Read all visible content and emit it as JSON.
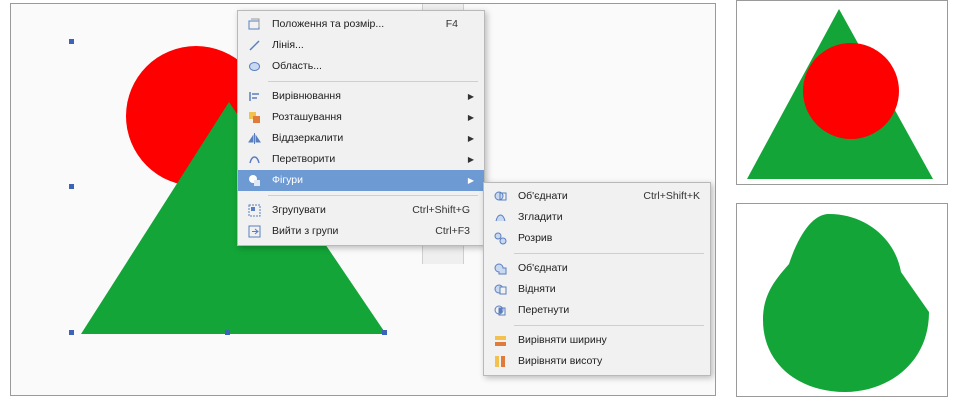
{
  "colors": {
    "shape_red": "#ff0000",
    "shape_green": "#13a538",
    "menu_highlight": "#6e9ad3",
    "menu_background": "#f1f1f1",
    "selection_handle": "#3b63b8"
  },
  "context_menu": {
    "items": [
      {
        "label": "Положення та розмір...",
        "shortcut": "F4",
        "icon": "position-size-icon"
      },
      {
        "label": "Лінія...",
        "shortcut": "",
        "icon": "line-icon"
      },
      {
        "label": "Область...",
        "shortcut": "",
        "icon": "area-icon"
      },
      {
        "label": "Вирівнювання",
        "shortcut": "",
        "icon": "align-icon",
        "submenu": true
      },
      {
        "label": "Розташування",
        "shortcut": "",
        "icon": "arrange-icon",
        "submenu": true
      },
      {
        "label": "Віддзеркалити",
        "shortcut": "",
        "icon": "flip-icon",
        "submenu": true
      },
      {
        "label": "Перетворити",
        "shortcut": "",
        "icon": "convert-icon",
        "submenu": true
      },
      {
        "label": "Фігури",
        "shortcut": "",
        "icon": "shapes-icon",
        "submenu": true,
        "active": true
      },
      {
        "label": "Згрупувати",
        "shortcut": "Ctrl+Shift+G",
        "icon": "group-icon"
      },
      {
        "label": "Вийти з групи",
        "shortcut": "Ctrl+F3",
        "icon": "exit-group-icon"
      }
    ]
  },
  "shapes_submenu": {
    "items": [
      {
        "label": "Об'єднати",
        "shortcut": "Ctrl+Shift+K",
        "icon": "combine-icon"
      },
      {
        "label": "Згладити",
        "shortcut": "",
        "icon": "smooth-icon"
      },
      {
        "label": "Розрив",
        "shortcut": "",
        "icon": "split-icon"
      },
      {
        "label": "Об'єднати",
        "shortcut": "",
        "icon": "merge-icon"
      },
      {
        "label": "Відняти",
        "shortcut": "",
        "icon": "subtract-icon"
      },
      {
        "label": "Перетнути",
        "shortcut": "",
        "icon": "intersect-icon"
      },
      {
        "label": "Вирівняти ширину",
        "shortcut": "",
        "icon": "equalize-width-icon"
      },
      {
        "label": "Вирівняти висоту",
        "shortcut": "",
        "icon": "equalize-height-icon"
      }
    ]
  }
}
